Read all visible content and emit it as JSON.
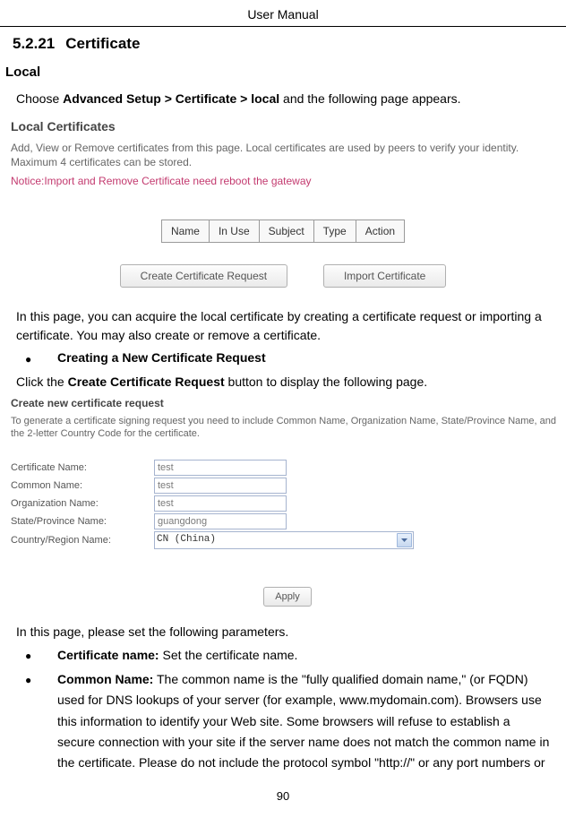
{
  "header": "User Manual",
  "section": {
    "number": "5.2.21",
    "title": "Certificate"
  },
  "subhead_local": "Local",
  "intro": {
    "prefix": "Choose ",
    "bold": "Advanced Setup > Certificate > local",
    "suffix": " and the following page appears."
  },
  "embedded1": {
    "title": "Local Certificates",
    "desc": "Add, View or Remove certificates from this page. Local certificates are used by peers to verify your identity. Maximum 4 certificates can be stored.",
    "notice": "Notice:Import and Remove Certificate need reboot the gateway",
    "columns": [
      "Name",
      "In Use",
      "Subject",
      "Type",
      "Action"
    ],
    "btn_create": "Create Certificate Request",
    "btn_import": "Import Certificate"
  },
  "para_after1": "In this page, you can acquire the local certificate by creating a certificate request or importing a certificate. You may also create or remove a certificate.",
  "bullet_creating": "Creating a New Certificate Request",
  "click_para": {
    "prefix": "Click the ",
    "bold": "Create Certificate Request",
    "suffix": " button to display the following page."
  },
  "embedded2": {
    "title": "Create new certificate request",
    "desc": "To generate a certificate signing request you need to include Common Name, Organization Name, State/Province Name, and the 2-letter Country Code for the certificate.",
    "fields": [
      {
        "label": "Certificate Name:",
        "value": "test"
      },
      {
        "label": "Common Name:",
        "value": "test"
      },
      {
        "label": "Organization Name:",
        "value": "test"
      },
      {
        "label": "State/Province Name:",
        "value": "guangdong"
      }
    ],
    "country_label": "Country/Region Name:",
    "country_value": "CN (China)",
    "apply": "Apply"
  },
  "para_setparams": "In this page, please set the following parameters.",
  "list": [
    {
      "bold": "Certificate name:",
      "rest": " Set the certificate name."
    },
    {
      "bold": "Common Name:",
      "rest": " The common name is the \"fully qualified domain name,\" (or FQDN) used for DNS lookups of your server (for example, www.mydomain.com). Browsers use this information to identify your Web site. Some browsers will refuse to establish a secure connection with your site if the server name does not match the common name in the certificate. Please do not include the protocol symbol \"http://\" or any port numbers or"
    }
  ],
  "pagenum": "90"
}
